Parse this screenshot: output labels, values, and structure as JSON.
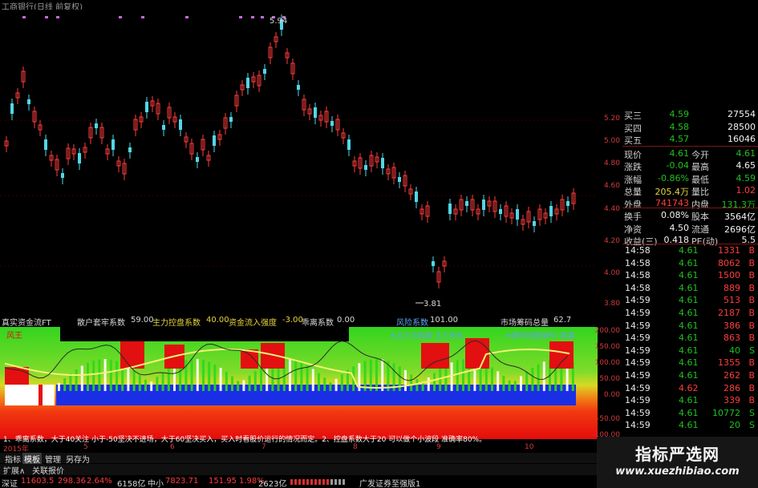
{
  "window": {
    "title": "工商银行(日线 前复权)"
  },
  "main_chart": {
    "high_label": "5.94",
    "low_label": "3.81",
    "price_axis": [
      "5.20",
      "5.00",
      "4.80",
      "4.60",
      "4.40",
      "4.20",
      "4.00",
      "3.80"
    ]
  },
  "indicator": {
    "name": "真实资金流FT",
    "params": [
      {
        "label": "散户套牢系数",
        "value": "59.00"
      },
      {
        "label": "主力控盘系数",
        "value": "40.00"
      },
      {
        "label": "资金流入强度",
        "value": "-3.00"
      },
      {
        "label": "乖离系数",
        "value": "0.00"
      },
      {
        "label": "风险系数",
        "value": "101.00"
      },
      {
        "label": "市场筹码总量",
        "value": "62.7"
      }
    ],
    "legend_left": "风王",
    "legend_mid": "★主力功吸筹  主力洗仓",
    "legend_right": "★操作控股操作! 筹建",
    "axis": [
      "200.00",
      "150.00",
      "100.00",
      "50.00",
      "0.00",
      "-50.00",
      "-100.00"
    ],
    "note": "1、乖离系数，大于40关注 小于-50坚决不进场，大于60坚决买入，买入时看股价运行的情况而定。2、控盘系数大于20 可以做个小波段 准确率80%。"
  },
  "x_axis": {
    "year": "2015年",
    "months": [
      "5",
      "6",
      "7",
      "8",
      "9",
      "10"
    ]
  },
  "tabs": [
    "指标",
    "模板",
    "管理",
    "另存为"
  ],
  "active_tab": "模板",
  "subtabs": [
    "扩展∧",
    "关联报价"
  ],
  "quote": {
    "bids": [
      {
        "label": "买三",
        "price": "4.59",
        "vol": "27554"
      },
      {
        "label": "买四",
        "price": "4.58",
        "vol": "28500"
      },
      {
        "label": "买五",
        "price": "4.57",
        "vol": "16046"
      }
    ],
    "stats": [
      {
        "l1": "现价",
        "v1": "4.61",
        "l2": "今开",
        "v2": "4.61",
        "c1": "green",
        "c2": "green"
      },
      {
        "l1": "涨跌",
        "v1": "-0.04",
        "l2": "最高",
        "v2": "4.65",
        "c1": "green",
        "c2": "white"
      },
      {
        "l1": "涨幅",
        "v1": "-0.86%",
        "l2": "最低",
        "v2": "4.59",
        "c1": "green",
        "c2": "green"
      },
      {
        "l1": "总量",
        "v1": "205.4万",
        "l2": "量比",
        "v2": "1.02",
        "c1": "yellow",
        "c2": "red"
      },
      {
        "l1": "外盘",
        "v1": "741743",
        "l2": "内盘",
        "v2": "131.3万",
        "c1": "red",
        "c2": "green"
      },
      {
        "l1": "换手",
        "v1": "0.08%",
        "l2": "股本",
        "v2": "3564亿",
        "c1": "white",
        "c2": "white"
      },
      {
        "l1": "净资",
        "v1": "4.50",
        "l2": "流通",
        "v2": "2696亿",
        "c1": "white",
        "c2": "white"
      },
      {
        "l1": "收益(三)",
        "v1": "0.418",
        "l2": "PE(动)",
        "v2": "5.5",
        "c1": "white",
        "c2": "white"
      }
    ]
  },
  "ticks": [
    {
      "time": "14:58",
      "price": "4.61",
      "vol": "1331",
      "dir": "B"
    },
    {
      "time": "14:58",
      "price": "4.61",
      "vol": "8062",
      "dir": "B"
    },
    {
      "time": "14:58",
      "price": "4.61",
      "vol": "1500",
      "dir": "B"
    },
    {
      "time": "14:58",
      "price": "4.61",
      "vol": "889",
      "dir": "B"
    },
    {
      "time": "14:59",
      "price": "4.61",
      "vol": "513",
      "dir": "B"
    },
    {
      "time": "14:59",
      "price": "4.61",
      "vol": "2187",
      "dir": "B"
    },
    {
      "time": "14:59",
      "price": "4.61",
      "vol": "386",
      "dir": "B"
    },
    {
      "time": "14:59",
      "price": "4.61",
      "vol": "863",
      "dir": "B"
    },
    {
      "time": "14:59",
      "price": "4.61",
      "vol": "40",
      "dir": "S"
    },
    {
      "time": "14:59",
      "price": "4.61",
      "vol": "1355",
      "dir": "B"
    },
    {
      "time": "14:59",
      "price": "4.61",
      "vol": "262",
      "dir": "B"
    },
    {
      "time": "14:59",
      "price": "4.62",
      "vol": "286",
      "dir": "B"
    },
    {
      "time": "14:59",
      "price": "4.61",
      "vol": "339",
      "dir": "B"
    },
    {
      "time": "14:59",
      "price": "4.61",
      "vol": "10772",
      "dir": "S"
    },
    {
      "time": "14:59",
      "price": "4.61",
      "vol": "20",
      "dir": "S"
    }
  ],
  "status": {
    "sh_label": "深证",
    "sh_value": "11603.5",
    "sh_change": "298.36",
    "sh_pct": "2.64%",
    "sh_amount": "6158亿",
    "zx_label": "中小",
    "zx_value": "7823.71",
    "zx_change": "151.95",
    "zx_pct": "1.98%",
    "zx_amount": "2623亿",
    "broker": "广发证券至强版1"
  },
  "watermark": {
    "cn": "指标严选网",
    "url": "www.xuezhibiao.com"
  },
  "colors": {
    "up": "#ff3d3d",
    "down": "#53d6e6",
    "accent": "#21c01e"
  }
}
